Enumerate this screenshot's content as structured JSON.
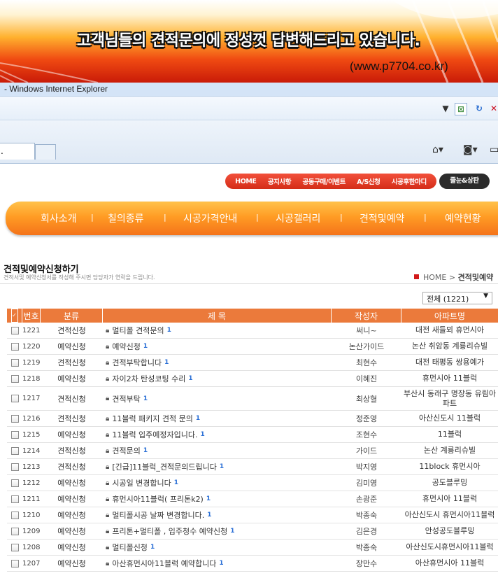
{
  "banner": {
    "slogan": "고객님들의 견적문의에 정성껏 답변해드리고 있습니다.",
    "url": "(www.p7704.co.kr)"
  },
  "browser": {
    "window_title": "- Windows Internet Explorer",
    "tab_label": "."
  },
  "top_nav": {
    "items": [
      "HOME",
      "공지사항",
      "공동구매/이벤트",
      "A/S신청",
      "시공후한마디"
    ],
    "extra": "줄눈&상판"
  },
  "main_menu": {
    "items": [
      "회사소개",
      "칠의종류",
      "시공가격안내",
      "시공갤러리",
      "견적및예약",
      "예약현황"
    ]
  },
  "page": {
    "title": "견적및예약신청하기",
    "description": "견적서및 예약신청서를 작성해 주시면 담당자가 연락을 드립니다.",
    "breadcrumb": {
      "home": "HOME",
      "separator": ">",
      "current": "견적및예약"
    }
  },
  "filter": {
    "selected": "전체 (1221)"
  },
  "table": {
    "headers": {
      "no": "번호",
      "category": "분류",
      "title": "제 목",
      "author": "작성자",
      "apartment": "아파트명"
    },
    "rows": [
      {
        "no": "1221",
        "category": "견적신청",
        "title": "멀티폴 견적문의",
        "comments": "1",
        "author": "써니~",
        "apartment": "대전 새들뫼 휴먼시아"
      },
      {
        "no": "1220",
        "category": "예약신청",
        "title": "예약신청",
        "comments": "1",
        "author": "논산가이드",
        "apartment": "논산 취암동 계룡리슈빌"
      },
      {
        "no": "1219",
        "category": "견적신청",
        "title": "견적부탁합니다",
        "comments": "1",
        "author": "최현수",
        "apartment": "대전 태평동 쌍용예가"
      },
      {
        "no": "1218",
        "category": "예약신청",
        "title": "자이2차 탄성코팅 수리",
        "comments": "1",
        "author": "이혜진",
        "apartment": "휴먼시아 11블럭"
      },
      {
        "no": "1217",
        "category": "견적신청",
        "title": "견적부탁",
        "comments": "1",
        "author": "최상혈",
        "apartment": "부산시 동래구 명장동 유림아파트"
      },
      {
        "no": "1216",
        "category": "견적신청",
        "title": "11블럭 패키지 견적 문의",
        "comments": "1",
        "author": "정준영",
        "apartment": "아산신도시 11블럭"
      },
      {
        "no": "1215",
        "category": "예약신청",
        "title": "11블럭 입주예정자입니다.",
        "comments": "1",
        "author": "조현수",
        "apartment": "11블럭"
      },
      {
        "no": "1214",
        "category": "견적신청",
        "title": "견적문의",
        "comments": "1",
        "author": "가이드",
        "apartment": "논산 계룡리슈빌"
      },
      {
        "no": "1213",
        "category": "견적신청",
        "title": "[긴급]11블럭_견적문의드립니다",
        "comments": "1",
        "author": "박지영",
        "apartment": "11block 휴먼시아"
      },
      {
        "no": "1212",
        "category": "예약신청",
        "title": "시공일 변경합니다",
        "comments": "1",
        "author": "김미영",
        "apartment": "공도블루밍"
      },
      {
        "no": "1211",
        "category": "예약신청",
        "title": "휴먼시아11블럭( 프리톤k2)",
        "comments": "1",
        "author": "손광준",
        "apartment": "휴먼시아 11블럭"
      },
      {
        "no": "1210",
        "category": "예약신청",
        "title": "멀티폴시공 날짜 변경합니다.",
        "comments": "1",
        "author": "박종숙",
        "apartment": "아산신도시 휴먼시아11블럭"
      },
      {
        "no": "1209",
        "category": "예약신청",
        "title": "프리톤+멀티폴 , 입주청수 예약신청",
        "comments": "1",
        "author": "김은경",
        "apartment": "안성공도블루밍"
      },
      {
        "no": "1208",
        "category": "예약신청",
        "title": "멀티폴신청",
        "comments": "1",
        "author": "박종숙",
        "apartment": "아산신도시휴먼시아11블럭"
      },
      {
        "no": "1207",
        "category": "예약신청",
        "title": "아산휴먼시아11블럭 예약합니다",
        "comments": "1",
        "author": "장만수",
        "apartment": "아산휴먼시아 11블럭"
      }
    ]
  },
  "colors": {
    "accent": "#eb7a3b",
    "nav_red": "#d42d18",
    "comment_count": "#2a6fd6"
  }
}
